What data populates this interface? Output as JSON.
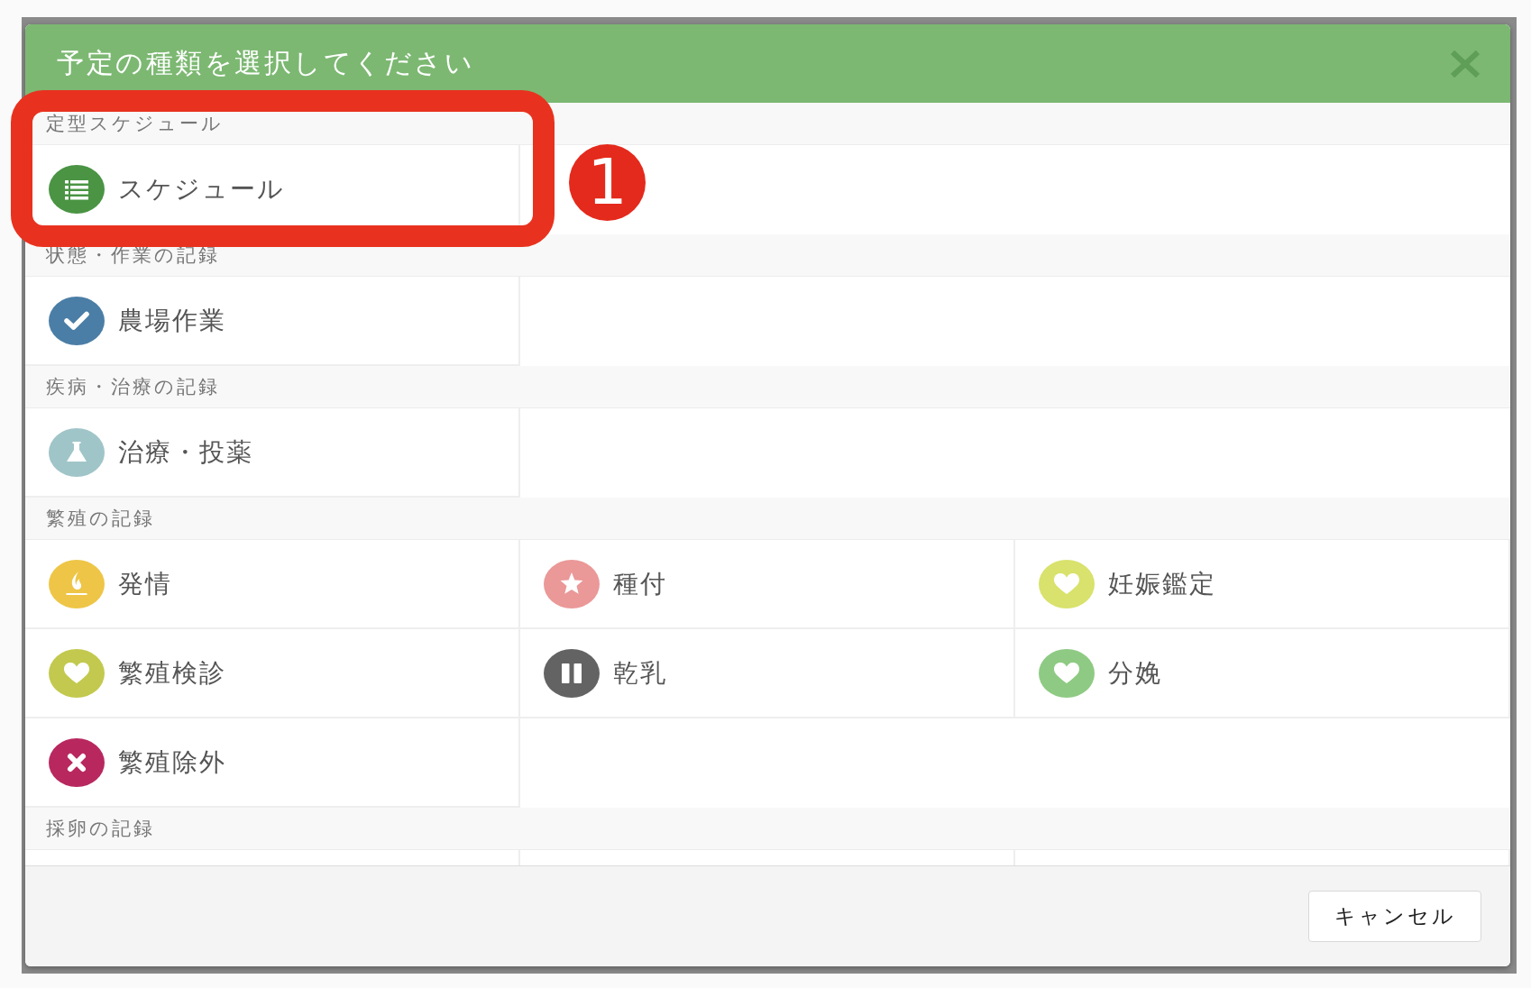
{
  "dialog": {
    "title": "予定の種類を選択してください"
  },
  "sections": [
    {
      "title": "定型スケジュール",
      "items": [
        {
          "label": "スケジュール",
          "kind": "list",
          "color": "#4a9444"
        }
      ]
    },
    {
      "title": "状態・作業の記録",
      "items": [
        {
          "label": "農場作業",
          "kind": "check",
          "color": "#4b7ea6"
        }
      ]
    },
    {
      "title": "疾病・治療の記録",
      "items": [
        {
          "label": "治療・投薬",
          "kind": "flask",
          "color": "#a0c5c8"
        }
      ]
    },
    {
      "title": "繁殖の記録",
      "items": [
        {
          "label": "発情",
          "kind": "flame",
          "color": "#eec546"
        },
        {
          "label": "種付",
          "kind": "star",
          "color": "#eb9898"
        },
        {
          "label": "妊娠鑑定",
          "kind": "heart",
          "color": "#d8e26c"
        },
        {
          "label": "繁殖検診",
          "kind": "heart",
          "color": "#c2c94e"
        },
        {
          "label": "乾乳",
          "kind": "pause",
          "color": "#636363"
        },
        {
          "label": "分娩",
          "kind": "heart",
          "color": "#8eca83"
        },
        {
          "label": "繁殖除外",
          "kind": "cross",
          "color": "#b8285f"
        }
      ]
    },
    {
      "title": "採卵の記録"
    }
  ],
  "footer": {
    "cancel_button": "キャンセル"
  },
  "annotation": {
    "badge": "1"
  }
}
